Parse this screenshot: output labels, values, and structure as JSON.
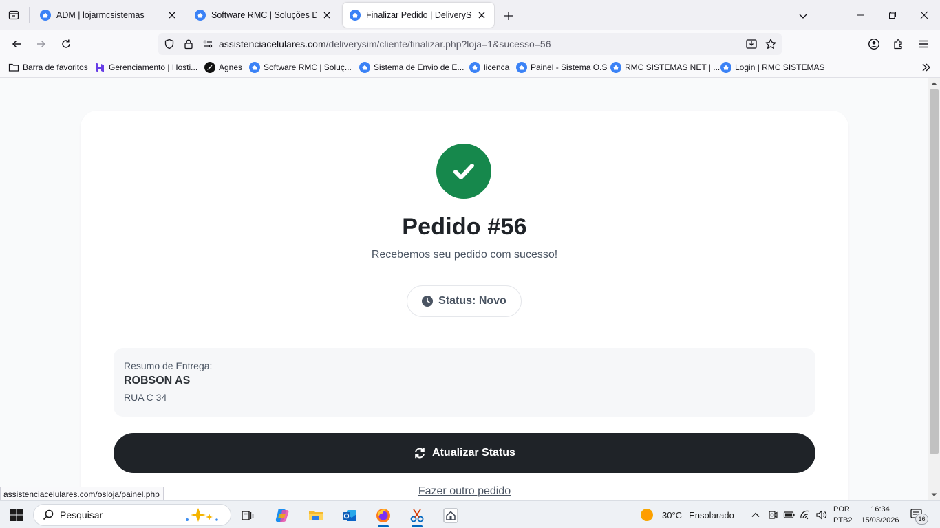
{
  "browser": {
    "tabs": [
      {
        "title": "ADM | lojarmcsistemas",
        "active": false
      },
      {
        "title": "Software RMC | Soluções Digita",
        "active": false
      },
      {
        "title": "Finalizar Pedido | DeliverySim",
        "active": true
      }
    ],
    "url_domain": "assistenciacelulares.com",
    "url_path": "/deliverysim/cliente/finalizar.php?loja=1&sucesso=56",
    "bookmarks_folder": "Barra de favoritos",
    "bookmarks": [
      "Gerenciamento | Hosti...",
      "Agnes",
      "Software RMC | Soluç...",
      "Sistema de Envio de E...",
      "licenca",
      "Painel - Sistema O.S",
      "RMC SISTEMAS NET | ...",
      "Login | RMC SISTEMAS"
    ],
    "status_link": "assistenciacelulares.com/osloja/painel.php"
  },
  "page": {
    "order_title": "Pedido #56",
    "subtitle": "Recebemos seu pedido com sucesso!",
    "status_label": "Status: Novo",
    "summary_label": "Resumo de Entrega:",
    "customer_name": "ROBSON AS",
    "address": "RUA C 34",
    "refresh_button": "Atualizar Status",
    "another_order_link": "Fazer outro pedido",
    "success_color": "#16884c",
    "button_color": "#1f2328"
  },
  "taskbar": {
    "search_placeholder": "Pesquisar",
    "weather_temp": "30°C",
    "weather_desc": "Ensolarado",
    "lang_line1": "POR",
    "lang_line2": "PTB2",
    "time": "16:34",
    "date": "15/03/2026",
    "notifications": "16"
  }
}
